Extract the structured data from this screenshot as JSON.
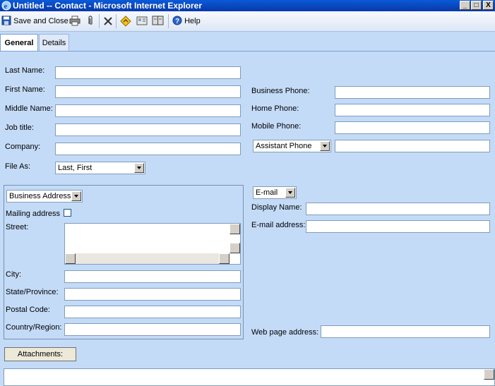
{
  "window": {
    "title": "Untitled -- Contact - Microsoft Internet Explorer",
    "min": "_",
    "max": "□",
    "close": "X"
  },
  "toolbar": {
    "save_close": "Save and Close",
    "help": "Help"
  },
  "tabs": [
    {
      "label": "General"
    },
    {
      "label": "Details"
    }
  ],
  "fields": {
    "last_name": "Last Name:",
    "first_name": "First Name:",
    "middle_name": "Middle Name:",
    "job_title": "Job title:",
    "company": "Company:",
    "file_as": "File As:",
    "file_as_value": "Last, First",
    "business_phone": "Business Phone:",
    "home_phone": "Home Phone:",
    "mobile_phone": "Mobile Phone:",
    "phone_type_value": "Assistant Phone"
  },
  "address": {
    "type_value": "Business Address",
    "mailing_address": "Mailing address",
    "street": "Street:",
    "city": "City:",
    "state": "State/Province:",
    "postal": "Postal Code:",
    "country": "Country/Region:"
  },
  "email": {
    "type_value": "E-mail",
    "display_name": "Display Name:",
    "email_address": "E-mail address:",
    "web_page": "Web page address:"
  },
  "attachments_label": "Attachments:"
}
